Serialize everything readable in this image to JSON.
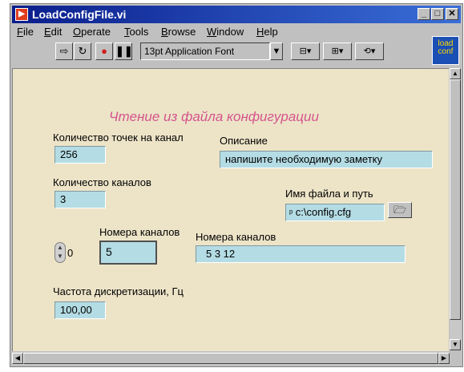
{
  "window": {
    "title": "LoadConfigFile.vi",
    "controls": {
      "minimize": "_",
      "maximize": "□",
      "close": "✕"
    }
  },
  "menu": [
    "File",
    "Edit",
    "Operate",
    "Tools",
    "Browse",
    "Window",
    "Help"
  ],
  "toolbar": {
    "font": "13pt Application Font",
    "icons": [
      "run-arrow-icon",
      "run-continuous-icon",
      "abort-icon",
      "pause-icon",
      "align-icon",
      "distribute-icon",
      "reorder-icon"
    ]
  },
  "logo": {
    "line1": "load",
    "line2": "conf"
  },
  "panel": {
    "heading": "Чтение из файла конфигурации",
    "points_label": "Количество точек на канал",
    "points_value": "256",
    "channels_label": "Количество каналов",
    "channels_value": "3",
    "description_label": "Описание",
    "description_value": "напишите необходимую заметку",
    "filepath_label": "Имя файла и путь",
    "filepath_value": "c:\\config.cfg",
    "array_index": "0",
    "channel_numbers_label": "Номера каналов",
    "channel_number_value": "5",
    "channel_numbers_label2": "Номера каналов",
    "channel_numbers_list": "5  3  12",
    "rate_label": "Частота дискретизации, Гц",
    "rate_value": "100,00"
  }
}
